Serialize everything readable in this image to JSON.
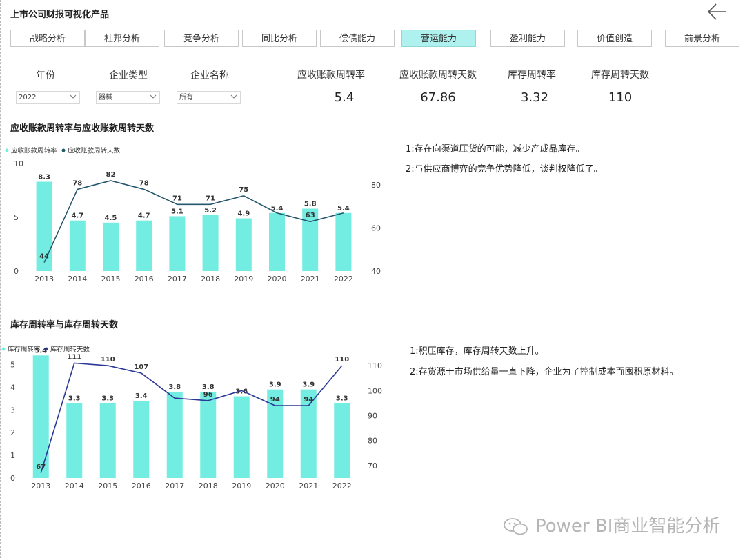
{
  "app": {
    "title": "上市公司财报可视化产品"
  },
  "nav": {
    "tabs": [
      {
        "label": "战略分析",
        "active": false
      },
      {
        "label": "杜邦分析",
        "active": false
      },
      {
        "label": "竞争分析",
        "active": false
      },
      {
        "label": "同比分析",
        "active": false
      },
      {
        "label": "偿债能力",
        "active": false
      },
      {
        "label": "营运能力",
        "active": true
      },
      {
        "label": "盈利能力",
        "active": false
      },
      {
        "label": "价值创造",
        "active": false
      },
      {
        "label": "前景分析",
        "active": false
      }
    ]
  },
  "filters": {
    "year": {
      "label": "年份",
      "value": "2022"
    },
    "type": {
      "label": "企业类型",
      "value": "器械"
    },
    "name": {
      "label": "企业名称",
      "value": "所有"
    }
  },
  "kpis": [
    {
      "label": "应收账款周转率",
      "value": "5.4"
    },
    {
      "label": "应收账款周转天数",
      "value": "67.86"
    },
    {
      "label": "库存周转率",
      "value": "3.32"
    },
    {
      "label": "库存周转天数",
      "value": "110"
    }
  ],
  "colors": {
    "bar": "#73ede2",
    "line_ar": "#24576b",
    "line_inv": "#2b3896",
    "accent_tab": "#aef1ee"
  },
  "chart_data": [
    {
      "type": "bar",
      "title": "应收账款周转率与应收账款周转天数",
      "categories": [
        "2013",
        "2014",
        "2015",
        "2016",
        "2017",
        "2018",
        "2019",
        "2020",
        "2021",
        "2022"
      ],
      "series": [
        {
          "name": "应收账款周转率",
          "type": "bar",
          "axis": "left",
          "values": [
            8.3,
            4.7,
            4.5,
            4.7,
            5.1,
            5.2,
            4.9,
            5.4,
            5.8,
            5.4
          ]
        },
        {
          "name": "应收账款周转天数",
          "type": "line",
          "axis": "right",
          "values": [
            44,
            78,
            82,
            78,
            71,
            71,
            75,
            67,
            63,
            67
          ],
          "labels": [
            "44",
            "78",
            "82",
            "78",
            "71",
            "71",
            "75",
            "",
            "63",
            ""
          ]
        }
      ],
      "y_left": {
        "min": 0,
        "max": 10,
        "ticks": [
          0,
          5,
          10
        ]
      },
      "y_right": {
        "min": 40,
        "max": 90,
        "ticks": [
          40,
          60,
          80
        ]
      },
      "legend": "top-left",
      "grid": false,
      "notes": [
        "1:存在向渠道压货的可能，减少产成品库存。",
        "2:与供应商博弈的竞争优势降低，谈判权降低了。"
      ]
    },
    {
      "type": "bar",
      "title": "库存周转率与库存周转天数",
      "categories": [
        "2013",
        "2014",
        "2015",
        "2016",
        "2017",
        "2018",
        "2019",
        "2020",
        "2021",
        "2022"
      ],
      "series": [
        {
          "name": "库存周转率",
          "type": "bar",
          "axis": "left",
          "values": [
            5.4,
            3.3,
            3.3,
            3.4,
            3.8,
            3.8,
            3.6,
            3.9,
            3.9,
            3.3
          ]
        },
        {
          "name": "库存周转天数",
          "type": "line",
          "axis": "right",
          "values": [
            67,
            111,
            110,
            107,
            97,
            96,
            100,
            94,
            94,
            110
          ],
          "labels": [
            "67",
            "111",
            "110",
            "107",
            "",
            "96",
            "",
            "94",
            "94",
            "110"
          ]
        }
      ],
      "y_left": {
        "min": 0,
        "max": 5.5,
        "ticks": [
          0,
          1,
          2,
          3,
          4,
          5
        ]
      },
      "y_right": {
        "min": 65,
        "max": 115,
        "ticks": [
          70,
          80,
          90,
          100,
          110
        ]
      },
      "legend": "top-left",
      "grid": false,
      "notes": [
        "1:积压库存，库存周转天数上升。",
        "2:存货源于市场供给量一直下降，企业为了控制成本而囤积原材料。"
      ]
    }
  ],
  "watermark": {
    "text": "Power BI商业智能分析"
  }
}
